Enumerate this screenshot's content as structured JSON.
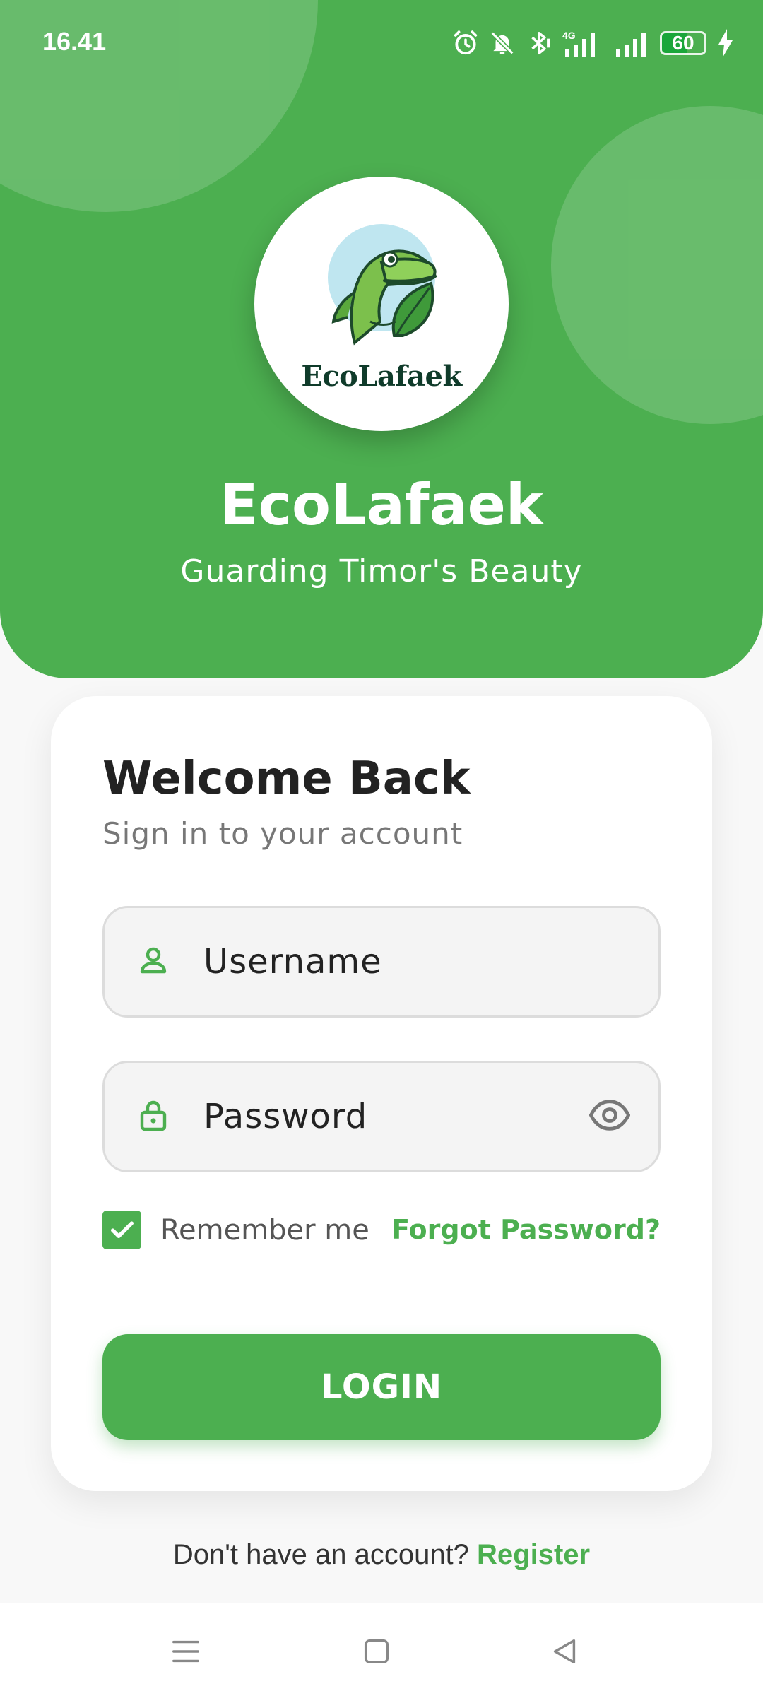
{
  "status_bar": {
    "time": "16.41",
    "network": "4G",
    "battery_level": "60",
    "icons": [
      "alarm-icon",
      "mute-icon",
      "bluetooth-icon",
      "signal-4g-icon",
      "signal-icon",
      "battery-icon",
      "charging-icon"
    ]
  },
  "header": {
    "logo_text": "EcoLafaek",
    "app_title": "EcoLafaek",
    "tagline": "Guarding Timor's Beauty"
  },
  "login_card": {
    "title": "Welcome Back",
    "subtitle": "Sign in to your account",
    "username_placeholder": "Username",
    "password_placeholder": "Password",
    "remember_label": "Remember me",
    "remember_checked": true,
    "forgot_label": "Forgot Password?",
    "login_label": "LOGIN"
  },
  "footer": {
    "register_prompt": "Don't have an account?",
    "register_link": "Register"
  },
  "nav_bar": {
    "buttons": [
      "menu-icon",
      "home-square-icon",
      "back-triangle-icon"
    ]
  },
  "colors": {
    "brand_green": "#4caf50",
    "dark_text": "#222222",
    "muted_text": "#777777",
    "background": "#f8f8f8"
  }
}
